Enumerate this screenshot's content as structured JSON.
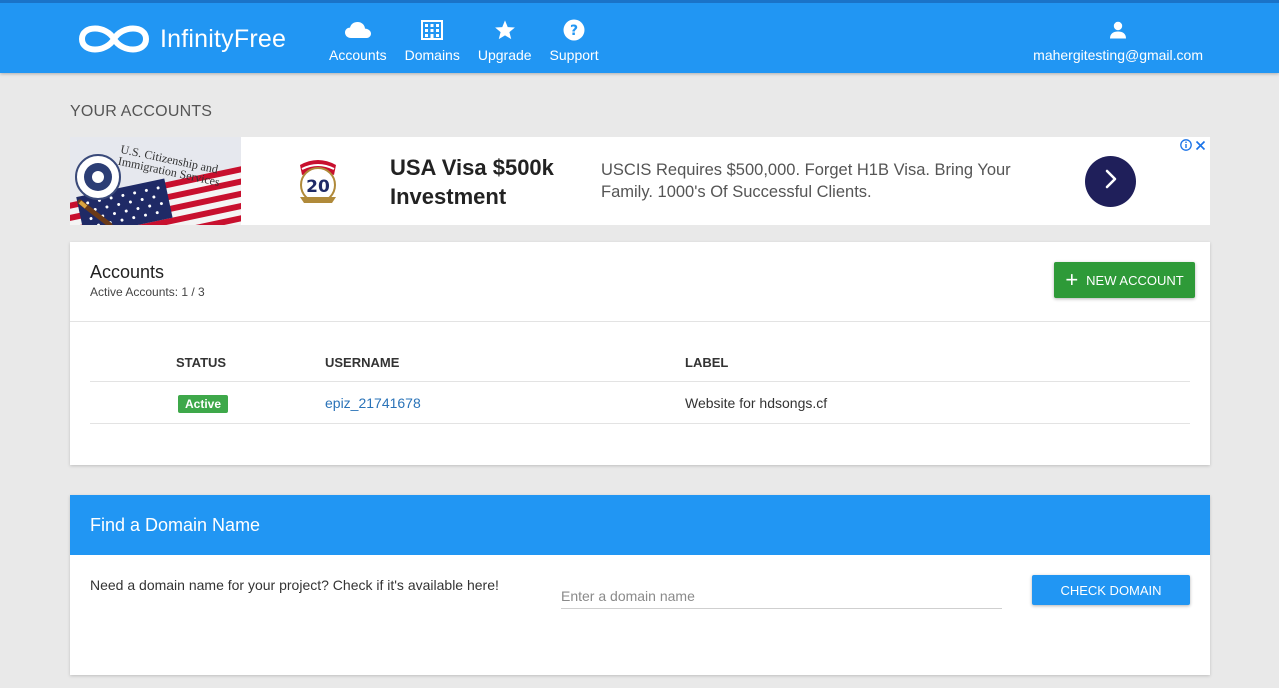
{
  "brand": {
    "name": "InfinityFree"
  },
  "nav": {
    "items": [
      {
        "label": "Accounts",
        "icon": "cloud-icon"
      },
      {
        "label": "Domains",
        "icon": "building-icon"
      },
      {
        "label": "Upgrade",
        "icon": "star-icon"
      },
      {
        "label": "Support",
        "icon": "help-icon"
      }
    ],
    "user": {
      "email": "mahergitesting@gmail.com",
      "icon": "user-icon"
    }
  },
  "page": {
    "heading": "YOUR ACCOUNTS"
  },
  "ad": {
    "headline": "USA Visa $500k Investment",
    "body": "USCIS Requires $500,000. Forget H1B Visa. Bring Your Family. 1000's Of Successful Clients.",
    "image_text": "U.S. Citizenship and Immigration Services",
    "seal_number": "20",
    "cta_icon": "chevron-right-icon",
    "choices_icons": [
      "info-icon",
      "close-icon"
    ]
  },
  "accounts": {
    "title": "Accounts",
    "subtitle": "Active Accounts: 1 / 3",
    "new_button": "NEW ACCOUNT",
    "columns": {
      "status": "STATUS",
      "username": "USERNAME",
      "label": "LABEL"
    },
    "rows": [
      {
        "status": "Active",
        "username": "epiz_21741678",
        "label": "Website for hdsongs.cf"
      }
    ]
  },
  "domain": {
    "title": "Find a Domain Name",
    "text": "Need a domain name for your project? Check if it's available here!",
    "input_placeholder": "Enter a domain name",
    "input_value": "",
    "button": "CHECK DOMAIN"
  },
  "colors": {
    "primary": "#2196f3",
    "success": "#2e9a38",
    "link": "#2a73b8",
    "background": "#e9e9e9"
  }
}
